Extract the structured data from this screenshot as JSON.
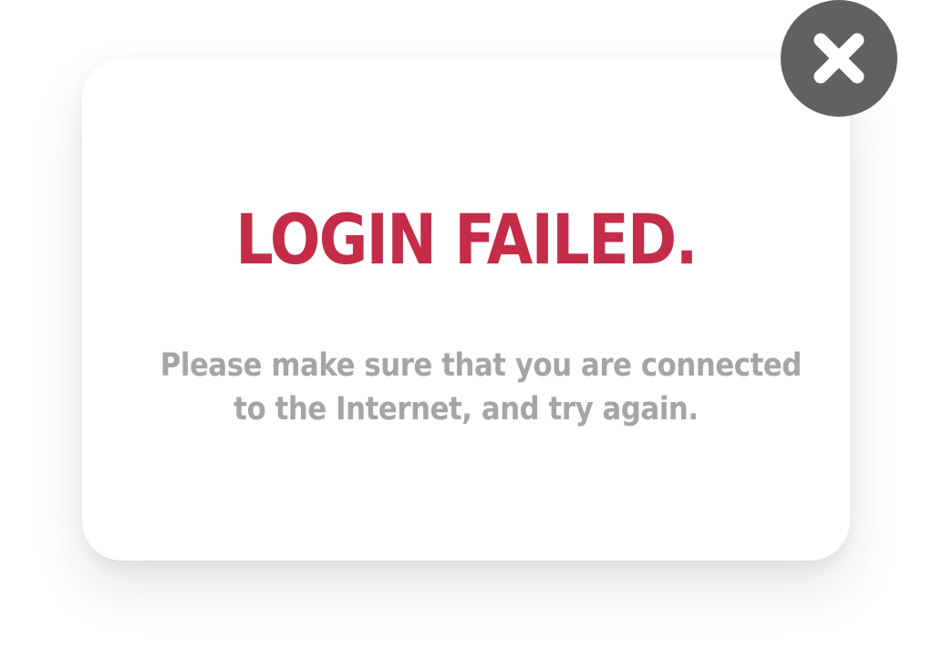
{
  "dialog": {
    "title": "LOGIN FAILED.",
    "message_line1": "Please make sure that you are connected",
    "message_line2": "to the Internet, and try again.",
    "close_icon": "close-icon"
  },
  "colors": {
    "title": "#c42c48",
    "message": "#a5a5a5",
    "close_button_bg": "#616161",
    "close_icon": "#ffffff",
    "background": "#ffffff"
  }
}
